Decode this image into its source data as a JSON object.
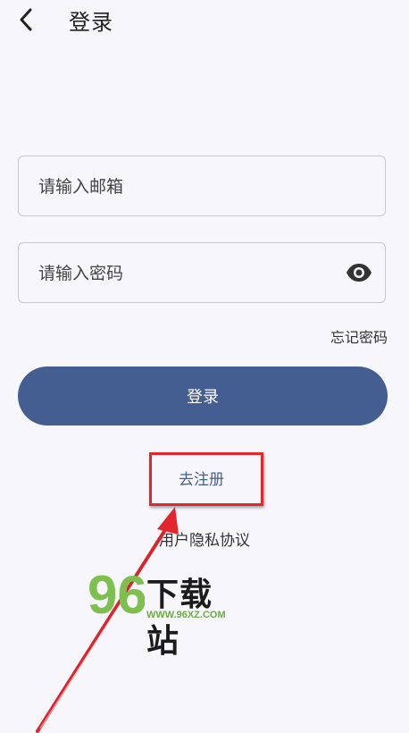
{
  "header": {
    "title": "登录"
  },
  "email": {
    "placeholder": "请输入邮箱",
    "value": ""
  },
  "password": {
    "placeholder": "请输入密码",
    "value": ""
  },
  "forgot_password": "忘记密码",
  "login_button": "登录",
  "register_link": "去注册",
  "privacy_link": "用户隐私协议",
  "watermark": {
    "logo_digits": "96",
    "title": "下载站",
    "site": "WWW.96XZ.COM"
  },
  "colors": {
    "background": "#f6f6fb",
    "primary": "#445e91",
    "annotation_red": "#e3262d",
    "watermark_green": "#6fa94a"
  },
  "icons": {
    "back": "chevron-left-icon",
    "password_visibility": "eye-icon"
  }
}
